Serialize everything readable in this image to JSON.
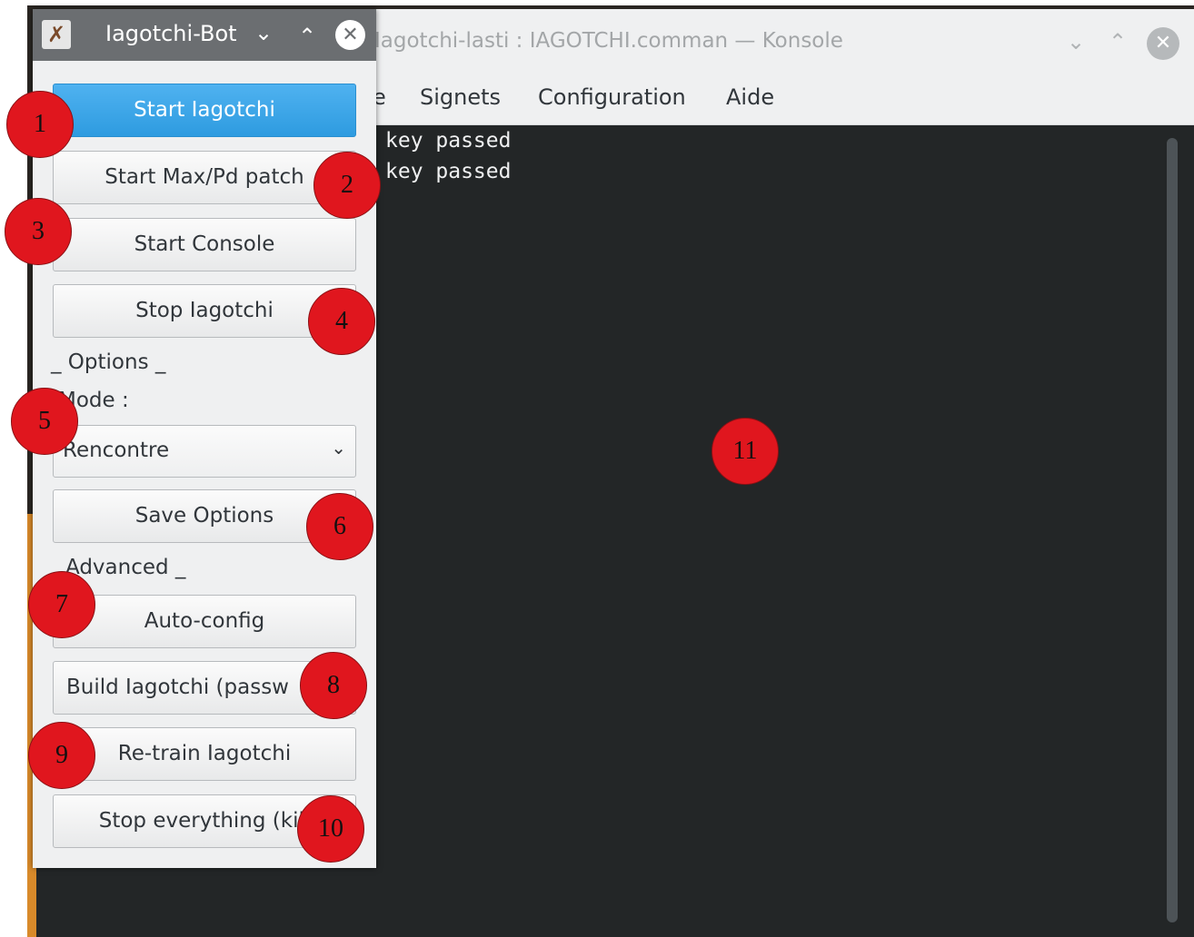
{
  "konsole": {
    "title": "Iagotchi-lasti : IAGOTCHI.comman — Konsole",
    "controls": {
      "minimize_icon": "chevron-down-icon",
      "maximize_icon": "chevron-up-icon",
      "close_icon": "close-icon"
    },
    "menu": [
      "e",
      "Signets",
      "Configuration",
      "Aide"
    ],
    "terminal_lines": [
      "key passed",
      "key passed"
    ]
  },
  "bot": {
    "title": "Iagotchi-Bot",
    "buttons": {
      "start_iagotchi": "Start Iagotchi",
      "start_patch": "Start Max/Pd patch",
      "start_console": "Start Console",
      "stop_iagotchi": "Stop Iagotchi",
      "save_options": "Save Options",
      "auto_config": "Auto-config",
      "build": "Build Iagotchi (passw",
      "retrain": "Re-train Iagotchi",
      "stop_everything": "Stop everything (kill"
    },
    "options_heading": "_ Options _",
    "mode_label": "Mode :",
    "mode_value": "Rencontre",
    "advanced_heading": "Advanced _"
  },
  "markers": [
    "1",
    "2",
    "3",
    "4",
    "5",
    "6",
    "7",
    "8",
    "9",
    "10",
    "11"
  ],
  "colors": {
    "accent": "#3daee9",
    "marker": "#e0161e",
    "terminal_bg": "#232627"
  }
}
